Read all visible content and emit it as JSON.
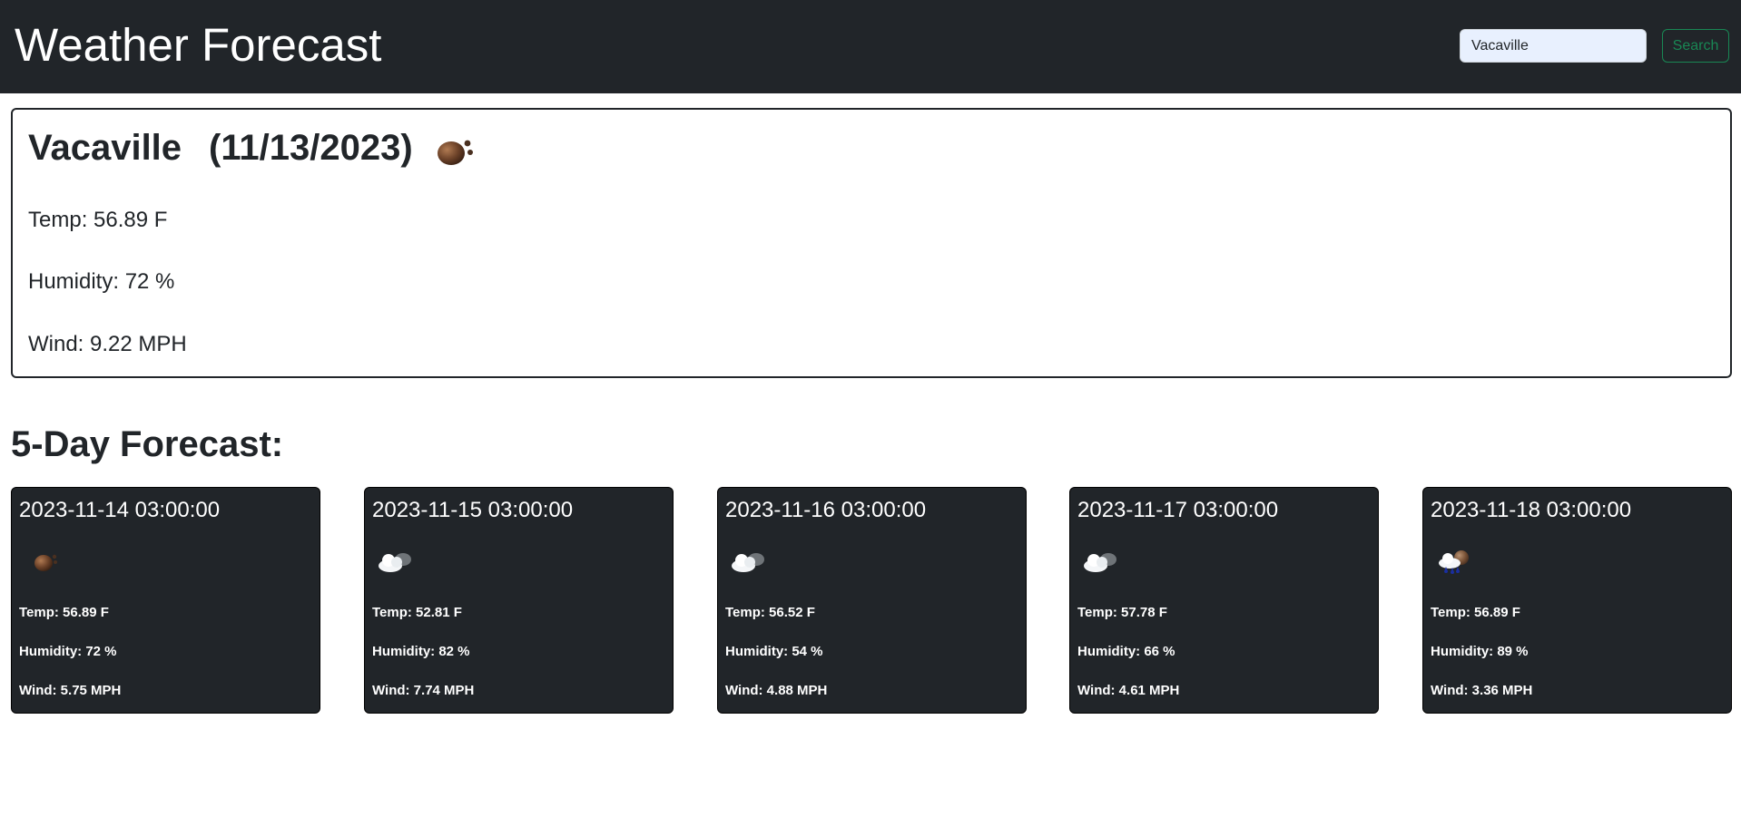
{
  "header": {
    "title": "Weather Forecast",
    "search_value": "Vacaville",
    "search_button_label": "Search"
  },
  "current": {
    "city": "Vacaville",
    "date": "(11/13/2023)",
    "icon": "dust-icon",
    "temp": "Temp: 56.89 F",
    "humidity": "Humidity: 72 %",
    "wind": "Wind: 9.22 MPH"
  },
  "forecast_heading": "5-Day Forecast:",
  "forecast": [
    {
      "date": "2023-11-14 03:00:00",
      "icon": "dust-icon",
      "temp": "Temp: 56.89 F",
      "humidity": "Humidity: 72 %",
      "wind": "Wind: 5.75 MPH"
    },
    {
      "date": "2023-11-15 03:00:00",
      "icon": "cloudy-icon",
      "temp": "Temp: 52.81 F",
      "humidity": "Humidity: 82 %",
      "wind": "Wind: 7.74 MPH"
    },
    {
      "date": "2023-11-16 03:00:00",
      "icon": "cloudy-icon",
      "temp": "Temp: 56.52 F",
      "humidity": "Humidity: 54 %",
      "wind": "Wind: 4.88 MPH"
    },
    {
      "date": "2023-11-17 03:00:00",
      "icon": "cloudy-icon",
      "temp": "Temp: 57.78 F",
      "humidity": "Humidity: 66 %",
      "wind": "Wind: 4.61 MPH"
    },
    {
      "date": "2023-11-18 03:00:00",
      "icon": "rain-icon",
      "temp": "Temp: 56.89 F",
      "humidity": "Humidity: 89 %",
      "wind": "Wind: 3.36 MPH"
    }
  ],
  "colors": {
    "navbar": "#212529",
    "card": "#212529",
    "search_button": "#198754",
    "input_fill": "#e8f0fe"
  }
}
